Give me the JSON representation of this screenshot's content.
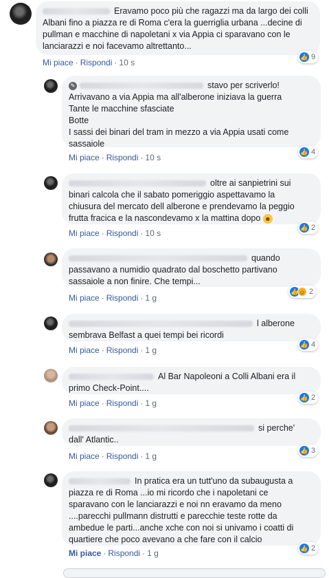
{
  "actions": {
    "like": "Mi piace",
    "reply": "Rispondi",
    "sep": "·"
  },
  "comments": [
    {
      "lines": [
        "Eravamo poco più che ragazzi ma da largo dei colli",
        "Albani fino a piazza re di Roma c'era la guerriglia urbana ...decine di",
        "pullman e macchine di napoletani x via Appia ci sparavano con le",
        "lanciarazzi e noi facevamo altrettanto..."
      ],
      "time": "10 s",
      "reactions": "9"
    },
    {
      "lines": [
        "stavo per scriverlo!",
        "Arrivavano a via Appia ma all'alberone iniziava la guerra",
        "Tante le macchine sfasciate",
        "Botte",
        "I sassi dei binari del tram in mezzo a via Appia usati come",
        "sassaiole"
      ],
      "time": "10 s",
      "reactions": "4"
    },
    {
      "lines": [
        "oltre ai sanpietrini sui",
        "binari calcola che il sabato pomeriggio aspettavamo la",
        "chiusura del mercato dell alberone e prendevamo la peggio",
        "frutta fracica e la nascondevamo x la mattina dopo"
      ],
      "time": "10 s",
      "reactions": "2"
    },
    {
      "lines": [
        "quando",
        "passavano a numidio quadrato dal boschetto partivano",
        "sassaiole a non finire. Che tempi..."
      ],
      "time": "1 g",
      "reactions": "2"
    },
    {
      "lines": [
        "l alberone",
        "sembrava Belfast a quei tempi bei ricordi"
      ],
      "time": "1 g",
      "reactions": "4"
    },
    {
      "lines": [
        "Al Bar Napoleoni a Colli Albani era il",
        "primo Check-Point...."
      ],
      "time": "1 g",
      "reactions": "2"
    },
    {
      "lines": [
        "si perche'",
        "dall' Atlantic.."
      ],
      "time": "1 g",
      "reactions": "3"
    },
    {
      "lines": [
        "In pratica era un tutt'uno da subaugusta a",
        "piazza re di Roma ...io mi ricordo che i napoletani ce",
        "sparavano con le lanciarazzi e noi nn eravamo da meno",
        "....parecchi pullmann distrutti e parecchie teste rotte da",
        "ambedue le parti...anche xche con noi si univamo i coatti di",
        "quartiere che poco avevano a che fare con il calcio"
      ],
      "time": "1 g",
      "reactions": "2"
    }
  ]
}
